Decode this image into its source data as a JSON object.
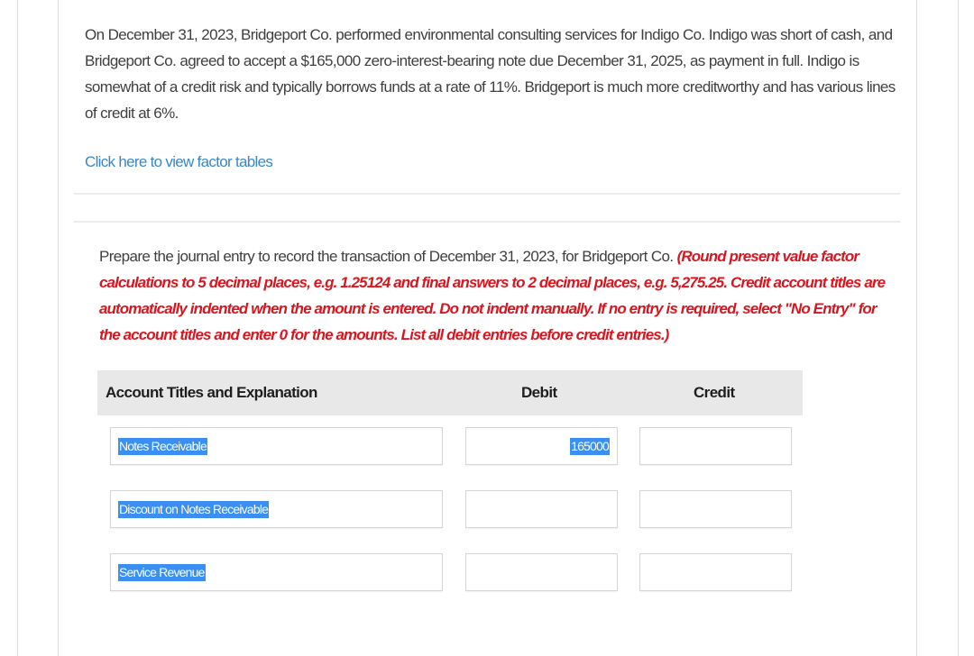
{
  "problem": {
    "text": "On December 31, 2023, Bridgeport Co. performed environmental consulting services for Indigo Co. Indigo was short of cash, and Bridgeport Co. agreed to accept a $165,000 zero-interest-bearing note due December 31, 2025, as payment in full. Indigo is somewhat of a credit risk and typically borrows funds at a rate of 11%. Bridgeport is much more creditworthy and has various lines of credit at 6%.",
    "factor_link": "Click here to view factor tables"
  },
  "instructions": {
    "lead": "Prepare the journal entry to record the transaction of December 31, 2023, for Bridgeport Co. ",
    "note": "(Round present value factor calculations to 5 decimal places, e.g. 1.25124 and final answers to 2 decimal places, e.g. 5,275.25. Credit account titles are automatically indented when the amount is entered. Do not indent manually. If no entry is required, select \"No Entry\" for the account titles and enter 0 for the amounts. List all debit entries before credit entries.)"
  },
  "journal": {
    "headers": {
      "account": "Account Titles and Explanation",
      "debit": "Debit",
      "credit": "Credit"
    },
    "rows": [
      {
        "account": "Notes Receivable",
        "debit": "165000",
        "credit": ""
      },
      {
        "account": "Discount on Notes Receivable",
        "debit": "",
        "credit": ""
      },
      {
        "account": "Service Revenue",
        "debit": "",
        "credit": ""
      }
    ]
  },
  "colors": {
    "link": "#3a87c6",
    "instruction_red": "#d9161f",
    "selection": "#3b8ff2",
    "header_bg": "#e8e8e8"
  }
}
